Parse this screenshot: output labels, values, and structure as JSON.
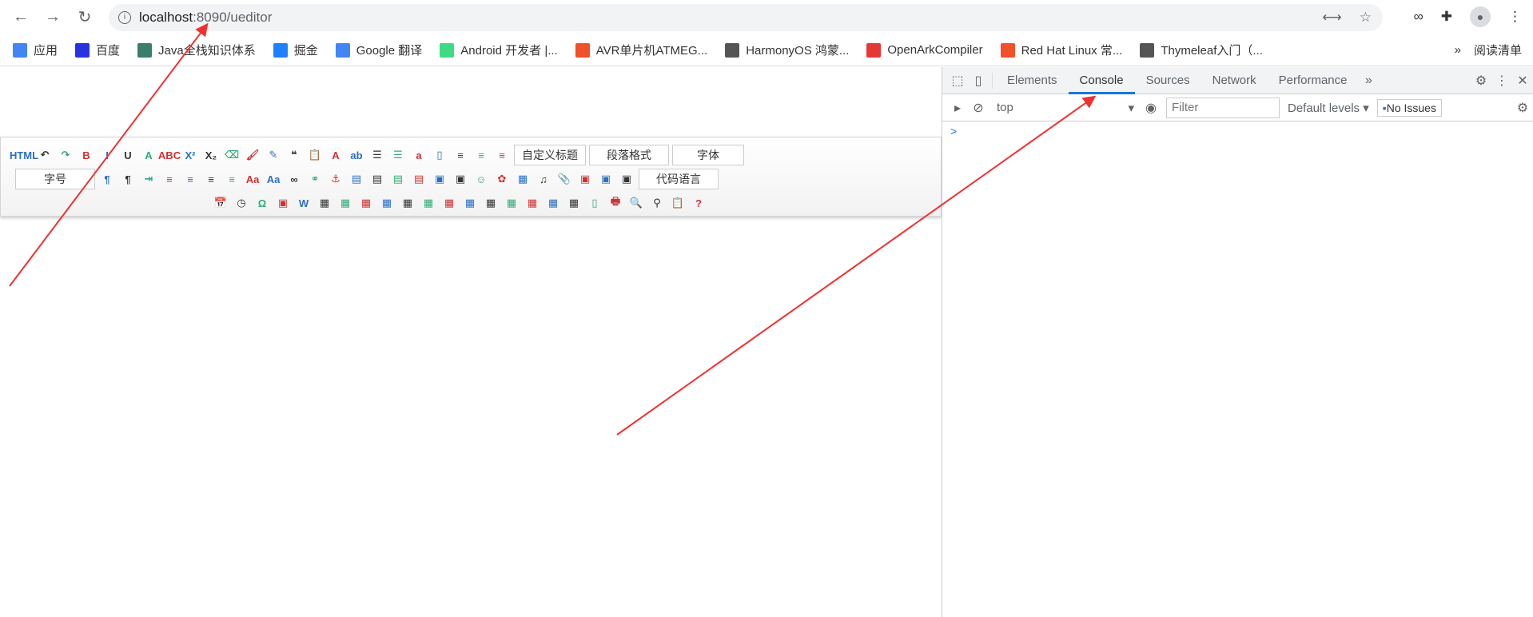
{
  "browser": {
    "url_host": "localhost",
    "url_path": ":8090/ueditor"
  },
  "bookmarks": [
    {
      "label": "应用",
      "color": "#4285f4"
    },
    {
      "label": "百度",
      "color": "#2932e1"
    },
    {
      "label": "Java全栈知识体系",
      "color": "#3a7d6b"
    },
    {
      "label": "掘金",
      "color": "#1e80ff"
    },
    {
      "label": "Google 翻译",
      "color": "#4285f4"
    },
    {
      "label": "Android 开发者 |...",
      "color": "#3ddc84"
    },
    {
      "label": "AVR单片机ATMEG...",
      "color": "#f0502a"
    },
    {
      "label": "HarmonyOS 鸿蒙...",
      "color": "#555"
    },
    {
      "label": "OpenArkCompiler",
      "color": "#e53935"
    },
    {
      "label": "Red Hat Linux 常...",
      "color": "#f0502a"
    },
    {
      "label": "Thymeleaf入门（...",
      "color": "#555"
    }
  ],
  "bookmarks_more": "»",
  "reading_list": "阅读清单",
  "editor": {
    "row1": [
      "HTML",
      "↶",
      "↷",
      "B",
      "I",
      "U",
      "A",
      "ABC",
      "X²",
      "X₂",
      "⌫",
      "🖌",
      "✎",
      "❝",
      "📋",
      "A",
      "ab",
      "☰",
      "☰",
      "a",
      "▯",
      "≡",
      "≡",
      "≡"
    ],
    "selects1": [
      "自定义标题",
      "段落格式",
      "字体"
    ],
    "font_size": "字号",
    "row2": [
      "¶",
      "¶",
      "⇥",
      "≡",
      "≡",
      "≡",
      "≡",
      "Aa",
      "Aa",
      "∞",
      "⚭",
      "⚓",
      "▤",
      "▤",
      "▤",
      "▤",
      "▣",
      "▣",
      "☺",
      "✿",
      "▦",
      "♫",
      "📎",
      "▣",
      "▣",
      "▣"
    ],
    "code_lang": "代码语言",
    "row3": [
      "📅",
      "◷",
      "Ω",
      "▣",
      "W",
      "▦",
      "▦",
      "▦",
      "▦",
      "▦",
      "▦",
      "▦",
      "▦",
      "▦",
      "▦",
      "▦",
      "▦",
      "▦",
      "▯",
      "🖶",
      "🔍",
      "⚲",
      "📋",
      "?"
    ]
  },
  "devtools": {
    "tabs": [
      "Elements",
      "Console",
      "Sources",
      "Network",
      "Performance"
    ],
    "active_tab": "Console",
    "context": "top",
    "filter_placeholder": "Filter",
    "levels": "Default levels",
    "issues": "No Issues",
    "prompt": ">"
  },
  "colors": {
    "accent": "#1a73e8",
    "arrow": "#f03030"
  }
}
